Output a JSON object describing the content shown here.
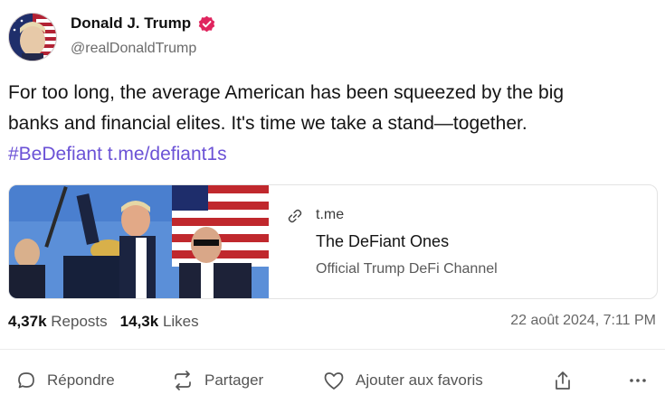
{
  "post": {
    "author_name": "Donald J. Trump",
    "handle": "@realDonaldTrump",
    "body_line1": "For too long, the average American has been squeezed by the big",
    "body_line2": "banks and financial elites. It's time we take a stand—together.",
    "hashtag": "#BeDefiant",
    "link": "t.me/defiant1s"
  },
  "link_card": {
    "domain": "t.me",
    "title": "The DeFiant Ones",
    "description": "Official Trump DeFi Channel"
  },
  "stats": {
    "reposts_count": "4,37k",
    "reposts_label": "Reposts",
    "likes_count": "14,3k",
    "likes_label": "Likes",
    "timestamp": "22 août 2024, 7:11 PM"
  },
  "actions": {
    "reply": "Répondre",
    "share": "Partager",
    "favorite": "Ajouter aux favoris",
    "upload_icon": "upload-icon",
    "more_icon": "more-icon"
  },
  "colors": {
    "hashtag": "#6b52d6",
    "verified_badge": "#e0245e"
  }
}
